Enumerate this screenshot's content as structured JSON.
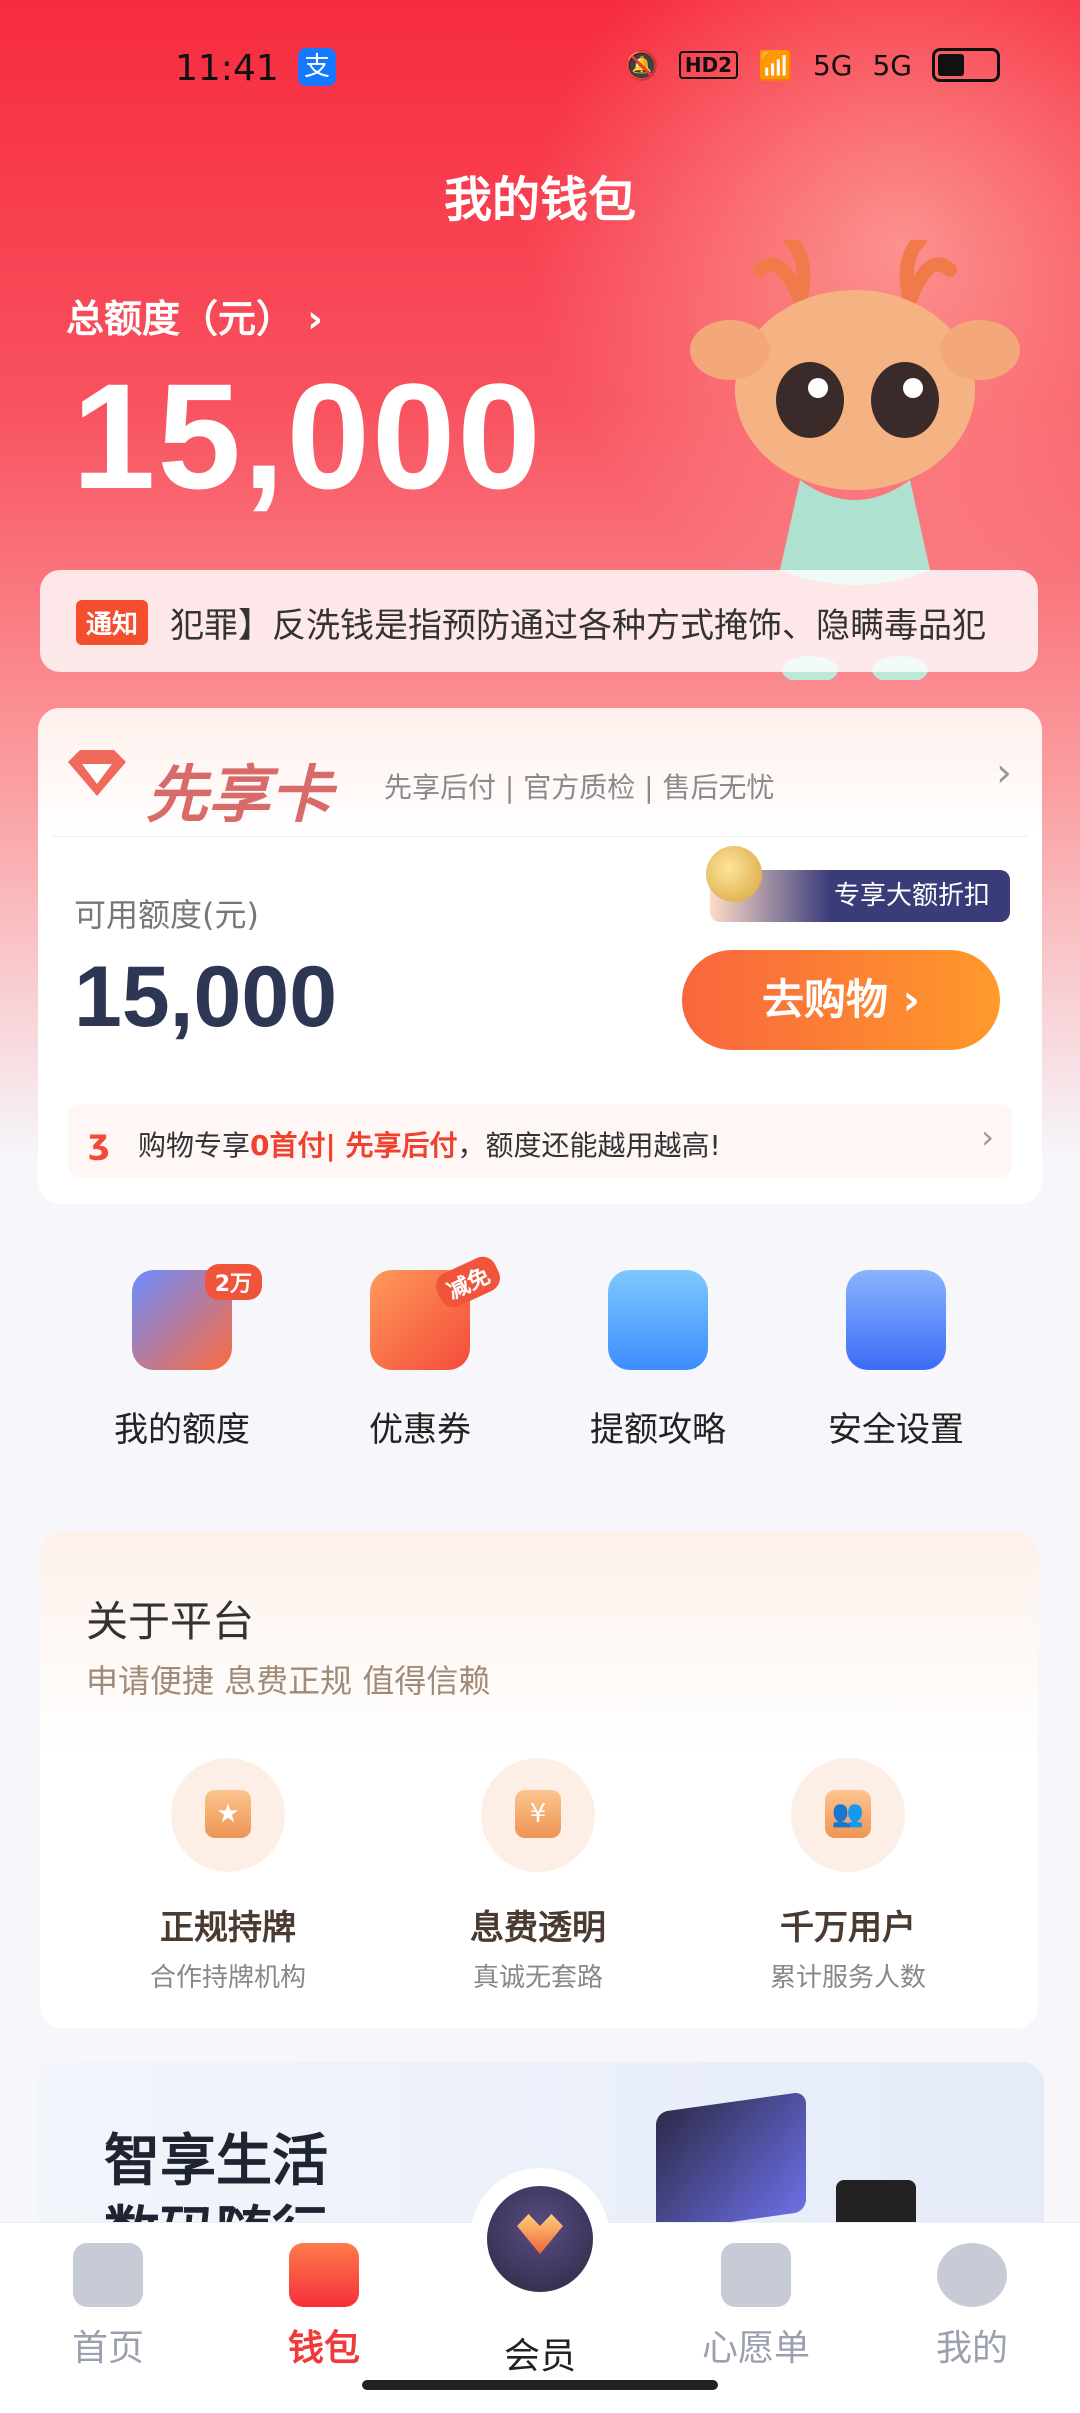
{
  "status_bar": {
    "time": "11:41",
    "alipay": "支",
    "network1": "5G",
    "network2": "5G",
    "hd": "HD2"
  },
  "header": {
    "title": "我的钱包"
  },
  "total": {
    "label": "总额度（元）",
    "value": "15,000"
  },
  "notice": {
    "tag": "通知",
    "text": "犯罪】反洗钱是指预防通过各种方式掩饰、隐瞒毒品犯"
  },
  "card": {
    "brand": "先享卡",
    "slogan": "先享后付 | 官方质检 | 售后无忧",
    "available_label": "可用额度(元)",
    "available_value": "15,000",
    "discount_label": "专享大额折扣",
    "shop_button": "去购物",
    "tip_prefix": "购物专享",
    "tip_highlight1": "0首付",
    "tip_sep": "| ",
    "tip_highlight2": "先享后付",
    "tip_suffix": "，额度还能越用越高!"
  },
  "quick_actions": [
    {
      "label": "我的额度",
      "badge": "2万"
    },
    {
      "label": "优惠券",
      "badge": "减免"
    },
    {
      "label": "提额攻略"
    },
    {
      "label": "安全设置"
    }
  ],
  "about": {
    "title": "关于平台",
    "subtitle": "申请便捷 息费正规 值得信赖",
    "features": [
      {
        "title": "正规持牌",
        "desc": "合作持牌机构"
      },
      {
        "title": "息费透明",
        "desc": "真诚无套路"
      },
      {
        "title": "千万用户",
        "desc": "累计服务人数"
      }
    ]
  },
  "banner": {
    "line1": "智享生活",
    "line2": "数码随行"
  },
  "tabs": [
    {
      "label": "首页",
      "active": false
    },
    {
      "label": "钱包",
      "active": true
    },
    {
      "label": "会员",
      "active": false
    },
    {
      "label": "心愿单",
      "active": false
    },
    {
      "label": "我的",
      "active": false
    }
  ],
  "colors": {
    "primary": "#f03a3a",
    "accent": "#f8663d",
    "dark_value": "#2d3652"
  }
}
